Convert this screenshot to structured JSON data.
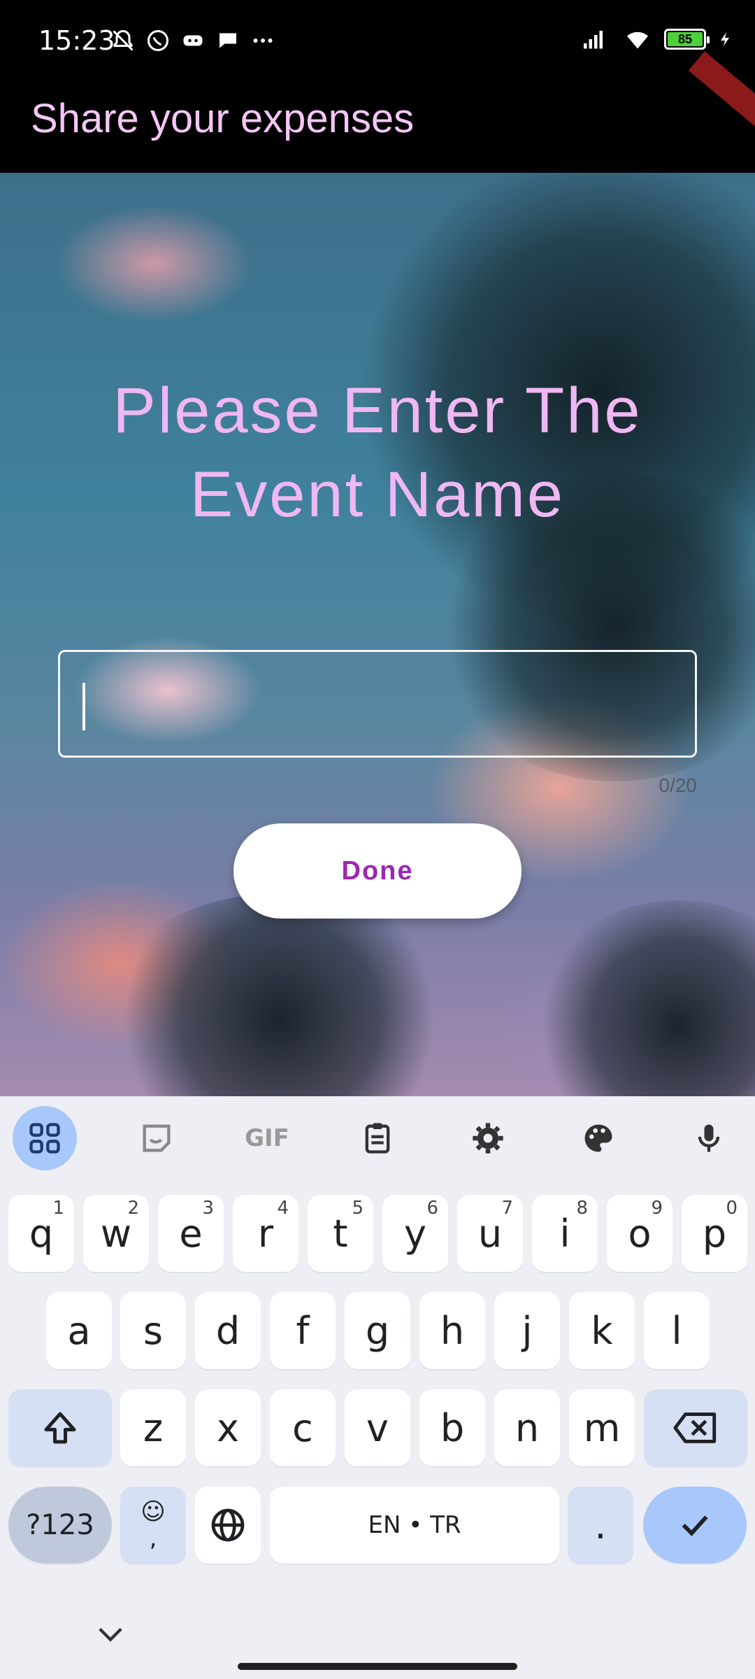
{
  "status_bar": {
    "time": "15:23",
    "battery_level": "85",
    "left_icons": [
      "mute-icon",
      "whatsapp-icon",
      "game-icon",
      "chat-bubble-icon",
      "more-icon"
    ],
    "right_icons": [
      "signal-icon",
      "wifi-icon",
      "battery-icon",
      "charging-icon"
    ]
  },
  "app_bar": {
    "title": "Share your expenses",
    "title_color": "#f5c6f6"
  },
  "content": {
    "prompt": "Please Enter The Event Name",
    "input_value": "",
    "counter": "0/20",
    "done_label": "Done",
    "accent": "#9c27b0",
    "prompt_color": "#f0b8f2"
  },
  "keyboard": {
    "toolbar": [
      "apps-icon",
      "sticker-icon",
      "gif-icon",
      "clipboard-icon",
      "settings-icon",
      "palette-icon",
      "mic-icon"
    ],
    "gif_label": "GIF",
    "row1": [
      {
        "k": "q",
        "h": "1"
      },
      {
        "k": "w",
        "h": "2"
      },
      {
        "k": "e",
        "h": "3"
      },
      {
        "k": "r",
        "h": "4"
      },
      {
        "k": "t",
        "h": "5"
      },
      {
        "k": "y",
        "h": "6"
      },
      {
        "k": "u",
        "h": "7"
      },
      {
        "k": "i",
        "h": "8"
      },
      {
        "k": "o",
        "h": "9"
      },
      {
        "k": "p",
        "h": "0"
      }
    ],
    "row2": [
      "a",
      "s",
      "d",
      "f",
      "g",
      "h",
      "j",
      "k",
      "l"
    ],
    "row3": [
      "z",
      "x",
      "c",
      "v",
      "b",
      "n",
      "m"
    ],
    "symbols_label": "?123",
    "emoji_label": "☺",
    "comma_label": ",",
    "space_label": "EN • TR",
    "period_label": "."
  }
}
